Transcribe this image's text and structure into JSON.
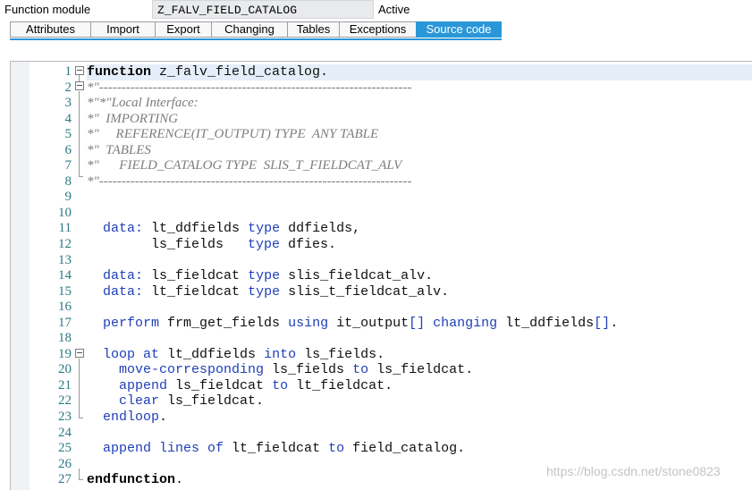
{
  "header": {
    "label": "Function module",
    "name": "Z_FALV_FIELD_CATALOG",
    "status": "Active"
  },
  "tabs": [
    {
      "label": "Attributes",
      "active": false
    },
    {
      "label": "Import",
      "active": false
    },
    {
      "label": "Export",
      "active": false
    },
    {
      "label": "Changing",
      "active": false
    },
    {
      "label": "Tables",
      "active": false
    },
    {
      "label": "Exceptions",
      "active": false
    },
    {
      "label": "Source code",
      "active": true
    }
  ],
  "colors": {
    "accent": "#2a97d8",
    "keyword": "#1f3fb8",
    "comment": "#7d7d7d",
    "line_number": "#2a7a85",
    "current_line": "#e5eef9"
  },
  "editor": {
    "lines": [
      {
        "no": "1",
        "segments": [
          [
            "strong",
            "function"
          ],
          [
            "plain",
            " z_falv_field_catalog."
          ]
        ]
      },
      {
        "no": "2",
        "segments": [
          [
            "cm",
            "*\"----------------------------------------------------------------------"
          ]
        ]
      },
      {
        "no": "3",
        "segments": [
          [
            "cm",
            "*\"*\"Local Interface:"
          ]
        ]
      },
      {
        "no": "4",
        "segments": [
          [
            "cm",
            "*\"  IMPORTING"
          ]
        ]
      },
      {
        "no": "5",
        "segments": [
          [
            "cm",
            "*\"     REFERENCE(IT_OUTPUT) TYPE  ANY TABLE"
          ]
        ]
      },
      {
        "no": "6",
        "segments": [
          [
            "cm",
            "*\"  TABLES"
          ]
        ]
      },
      {
        "no": "7",
        "segments": [
          [
            "cm",
            "*\"      FIELD_CATALOG TYPE  SLIS_T_FIELDCAT_ALV"
          ]
        ]
      },
      {
        "no": "8",
        "segments": [
          [
            "cm",
            "*\"----------------------------------------------------------------------"
          ]
        ]
      },
      {
        "no": "9",
        "segments": []
      },
      {
        "no": "10",
        "segments": []
      },
      {
        "no": "11",
        "segments": [
          [
            "plain",
            "  "
          ],
          [
            "kw",
            "data:"
          ],
          [
            "plain",
            " lt_ddfields "
          ],
          [
            "kw",
            "type"
          ],
          [
            "plain",
            " ddfields,"
          ]
        ]
      },
      {
        "no": "12",
        "segments": [
          [
            "plain",
            "        ls_fields   "
          ],
          [
            "kw",
            "type"
          ],
          [
            "plain",
            " dfies."
          ]
        ]
      },
      {
        "no": "13",
        "segments": []
      },
      {
        "no": "14",
        "segments": [
          [
            "plain",
            "  "
          ],
          [
            "kw",
            "data:"
          ],
          [
            "plain",
            " ls_fieldcat "
          ],
          [
            "kw",
            "type"
          ],
          [
            "plain",
            " slis_fieldcat_alv."
          ]
        ]
      },
      {
        "no": "15",
        "segments": [
          [
            "plain",
            "  "
          ],
          [
            "kw",
            "data:"
          ],
          [
            "plain",
            " lt_fieldcat "
          ],
          [
            "kw",
            "type"
          ],
          [
            "plain",
            " slis_t_fieldcat_alv."
          ]
        ]
      },
      {
        "no": "16",
        "segments": []
      },
      {
        "no": "17",
        "segments": [
          [
            "plain",
            "  "
          ],
          [
            "kw",
            "perform"
          ],
          [
            "plain",
            " frm_get_fields "
          ],
          [
            "kw",
            "using"
          ],
          [
            "plain",
            " it_output"
          ],
          [
            "kw",
            "[]"
          ],
          [
            "plain",
            " "
          ],
          [
            "kw",
            "changing"
          ],
          [
            "plain",
            " lt_ddfields"
          ],
          [
            "kw",
            "[]"
          ],
          [
            "plain",
            "."
          ]
        ]
      },
      {
        "no": "18",
        "segments": []
      },
      {
        "no": "19",
        "segments": [
          [
            "plain",
            "  "
          ],
          [
            "kw",
            "loop at"
          ],
          [
            "plain",
            " lt_ddfields "
          ],
          [
            "kw",
            "into"
          ],
          [
            "plain",
            " ls_fields."
          ]
        ]
      },
      {
        "no": "20",
        "segments": [
          [
            "plain",
            "    "
          ],
          [
            "kw",
            "move-corresponding"
          ],
          [
            "plain",
            " ls_fields "
          ],
          [
            "kw",
            "to"
          ],
          [
            "plain",
            " ls_fieldcat."
          ]
        ]
      },
      {
        "no": "21",
        "segments": [
          [
            "plain",
            "    "
          ],
          [
            "kw",
            "append"
          ],
          [
            "plain",
            " ls_fieldcat "
          ],
          [
            "kw",
            "to"
          ],
          [
            "plain",
            " lt_fieldcat."
          ]
        ]
      },
      {
        "no": "22",
        "segments": [
          [
            "plain",
            "    "
          ],
          [
            "kw",
            "clear"
          ],
          [
            "plain",
            " ls_fieldcat."
          ]
        ]
      },
      {
        "no": "23",
        "segments": [
          [
            "plain",
            "  "
          ],
          [
            "kw",
            "endloop"
          ],
          [
            "plain",
            "."
          ]
        ]
      },
      {
        "no": "24",
        "segments": []
      },
      {
        "no": "25",
        "segments": [
          [
            "plain",
            "  "
          ],
          [
            "kw",
            "append lines of"
          ],
          [
            "plain",
            " lt_fieldcat "
          ],
          [
            "kw",
            "to"
          ],
          [
            "plain",
            " field_catalog."
          ]
        ]
      },
      {
        "no": "26",
        "segments": []
      },
      {
        "no": "27",
        "segments": [
          [
            "strong",
            "endfunction"
          ],
          [
            "plain",
            "."
          ]
        ]
      }
    ]
  },
  "watermark": "https://blog.csdn.net/stone0823"
}
